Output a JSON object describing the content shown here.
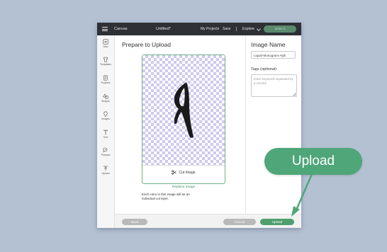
{
  "colors": {
    "background": "#b4c1d3",
    "accent_green": "#4ea679",
    "topbar": "#2e3035"
  },
  "topbar": {
    "menu_icon": "hamburger-icon",
    "app_name": "Canvas",
    "document_title": "Untitled*",
    "my_projects": "My Projects",
    "save": "Save",
    "machine": "Explore",
    "make_it": "Make It"
  },
  "sidebar": {
    "items": [
      {
        "label": "New",
        "icon": "plus-square-icon"
      },
      {
        "label": "Templates",
        "icon": "shirt-icon"
      },
      {
        "label": "Projects",
        "icon": "projects-icon"
      },
      {
        "label": "Shapes",
        "icon": "shapes-icon"
      },
      {
        "label": "Images",
        "icon": "lightbulb-icon"
      },
      {
        "label": "Text",
        "icon": "text-icon"
      },
      {
        "label": "Phrases",
        "icon": "chat-bubble-icon"
      },
      {
        "label": "Upload",
        "icon": "upload-icon"
      }
    ]
  },
  "main": {
    "title": "Prepare to Upload",
    "preview": {
      "cut_image_label": "Cut Image",
      "cut_icon": "scissors-icon"
    },
    "replace_link": "Replace Image",
    "info_text": "Each color in this image will be an individual cut layer."
  },
  "details": {
    "name_label": "Image Name",
    "name_value": "Liquid-Monogram-Alph",
    "tags_label": "Tags (optional)",
    "tags_placeholder": "Enter keywords separated by a comma"
  },
  "footer": {
    "back": "Back",
    "cancel": "Cancel",
    "upload": "Upload"
  },
  "callout": {
    "label": "Upload"
  }
}
